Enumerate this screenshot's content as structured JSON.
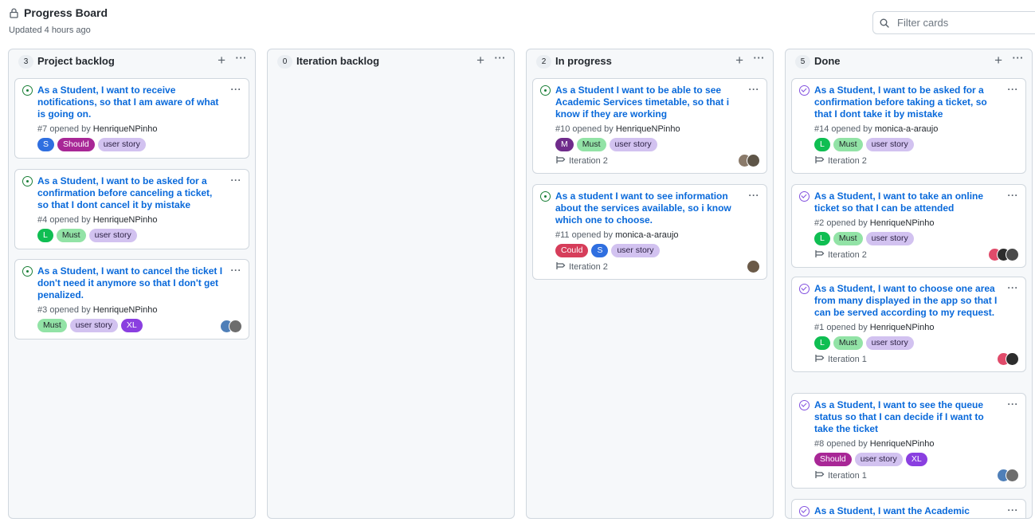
{
  "header": {
    "title": "Progress Board",
    "updated": "Updated 4 hours ago",
    "lock_icon": "lock-icon"
  },
  "filter": {
    "placeholder": "Filter cards",
    "icon": "search-icon"
  },
  "columns": [
    {
      "count": "3",
      "name": "Project backlog",
      "cards": [
        {
          "title": "As a Student, I want to receive notifications, so that I am aware of what is going on.",
          "number": "#7",
          "opened_by": "opened by",
          "author": "HenriqueNPinho",
          "state": "open",
          "labels": [
            "S",
            "Should",
            "user story"
          ],
          "avatars": []
        },
        {
          "title": "As a Student, I want to be asked for a confirmation before canceling a ticket, so that I dont cancel it by mistake",
          "number": "#4",
          "opened_by": "opened by",
          "author": "HenriqueNPinho",
          "state": "open",
          "labels": [
            "L",
            "Must",
            "user story"
          ],
          "avatars": []
        },
        {
          "title": "As a Student, I want to cancel the ticket I don't need it anymore so that I don't get penalized.",
          "number": "#3",
          "opened_by": "opened by",
          "author": "HenriqueNPinho",
          "state": "open",
          "labels": [
            "Must",
            "user story",
            "XL"
          ],
          "avatars": [
            "#4f7fb8",
            "#6d6d6d"
          ]
        }
      ]
    },
    {
      "count": "0",
      "name": "Iteration backlog",
      "cards": []
    },
    {
      "count": "2",
      "name": "In progress",
      "cards": [
        {
          "title": "As a Student I want to be able to see Academic Services timetable, so that i know if they are working",
          "number": "#10",
          "opened_by": "opened by",
          "author": "HenriqueNPinho",
          "state": "open",
          "labels": [
            "M",
            "Must",
            "user story"
          ],
          "iteration": "Iteration 2",
          "avatars": [
            "#8a7a6a",
            "#5e5548"
          ]
        },
        {
          "title": "As a student I want to see information about the services available, so i know which one to choose.",
          "number": "#11",
          "opened_by": "opened by",
          "author": "monica-a-araujo",
          "state": "open",
          "labels": [
            "Could",
            "S",
            "user story"
          ],
          "iteration": "Iteration 2",
          "avatars": [
            "#6b5a48"
          ]
        }
      ]
    },
    {
      "count": "5",
      "name": "Done",
      "cards": [
        {
          "title": "As a Student, I want to be asked for a confirmation before taking a ticket, so that I dont take it by mistake",
          "number": "#14",
          "opened_by": "opened by",
          "author": "monica-a-araujo",
          "state": "closed",
          "labels": [
            "L",
            "Must",
            "user story"
          ],
          "iteration": "Iteration 2",
          "avatars": []
        },
        {
          "title": "As a Student, I want to take an online ticket so that I can be attended",
          "number": "#2",
          "opened_by": "opened by",
          "author": "HenriqueNPinho",
          "state": "closed",
          "labels": [
            "L",
            "Must",
            "user story"
          ],
          "iteration": "Iteration 2",
          "avatars": [
            "#e04b6a",
            "#2d2d2d",
            "#4a4a4a"
          ]
        },
        {
          "title": "As a Student, I want to choose one area from many displayed in the app so that I can be served according to my request.",
          "number": "#1",
          "opened_by": "opened by",
          "author": "HenriqueNPinho",
          "state": "closed",
          "labels": [
            "L",
            "Must",
            "user story"
          ],
          "iteration": "Iteration 1",
          "avatars": [
            "#e04b6a",
            "#2d2d2d"
          ]
        },
        {
          "title": "As a Student, I want to see the queue status so that I can decide if I want to take the ticket",
          "number": "#8",
          "opened_by": "opened by",
          "author": "HenriqueNPinho",
          "state": "closed",
          "labels": [
            "Should",
            "user story",
            "XL"
          ],
          "iteration": "Iteration 1",
          "avatars": [
            "#4f7fb8",
            "#6d6d6d"
          ]
        },
        {
          "title": "As a Student, I want the Academic",
          "number": "",
          "opened_by": "",
          "author": "",
          "state": "closed",
          "labels": [],
          "avatars": []
        }
      ]
    }
  ]
}
